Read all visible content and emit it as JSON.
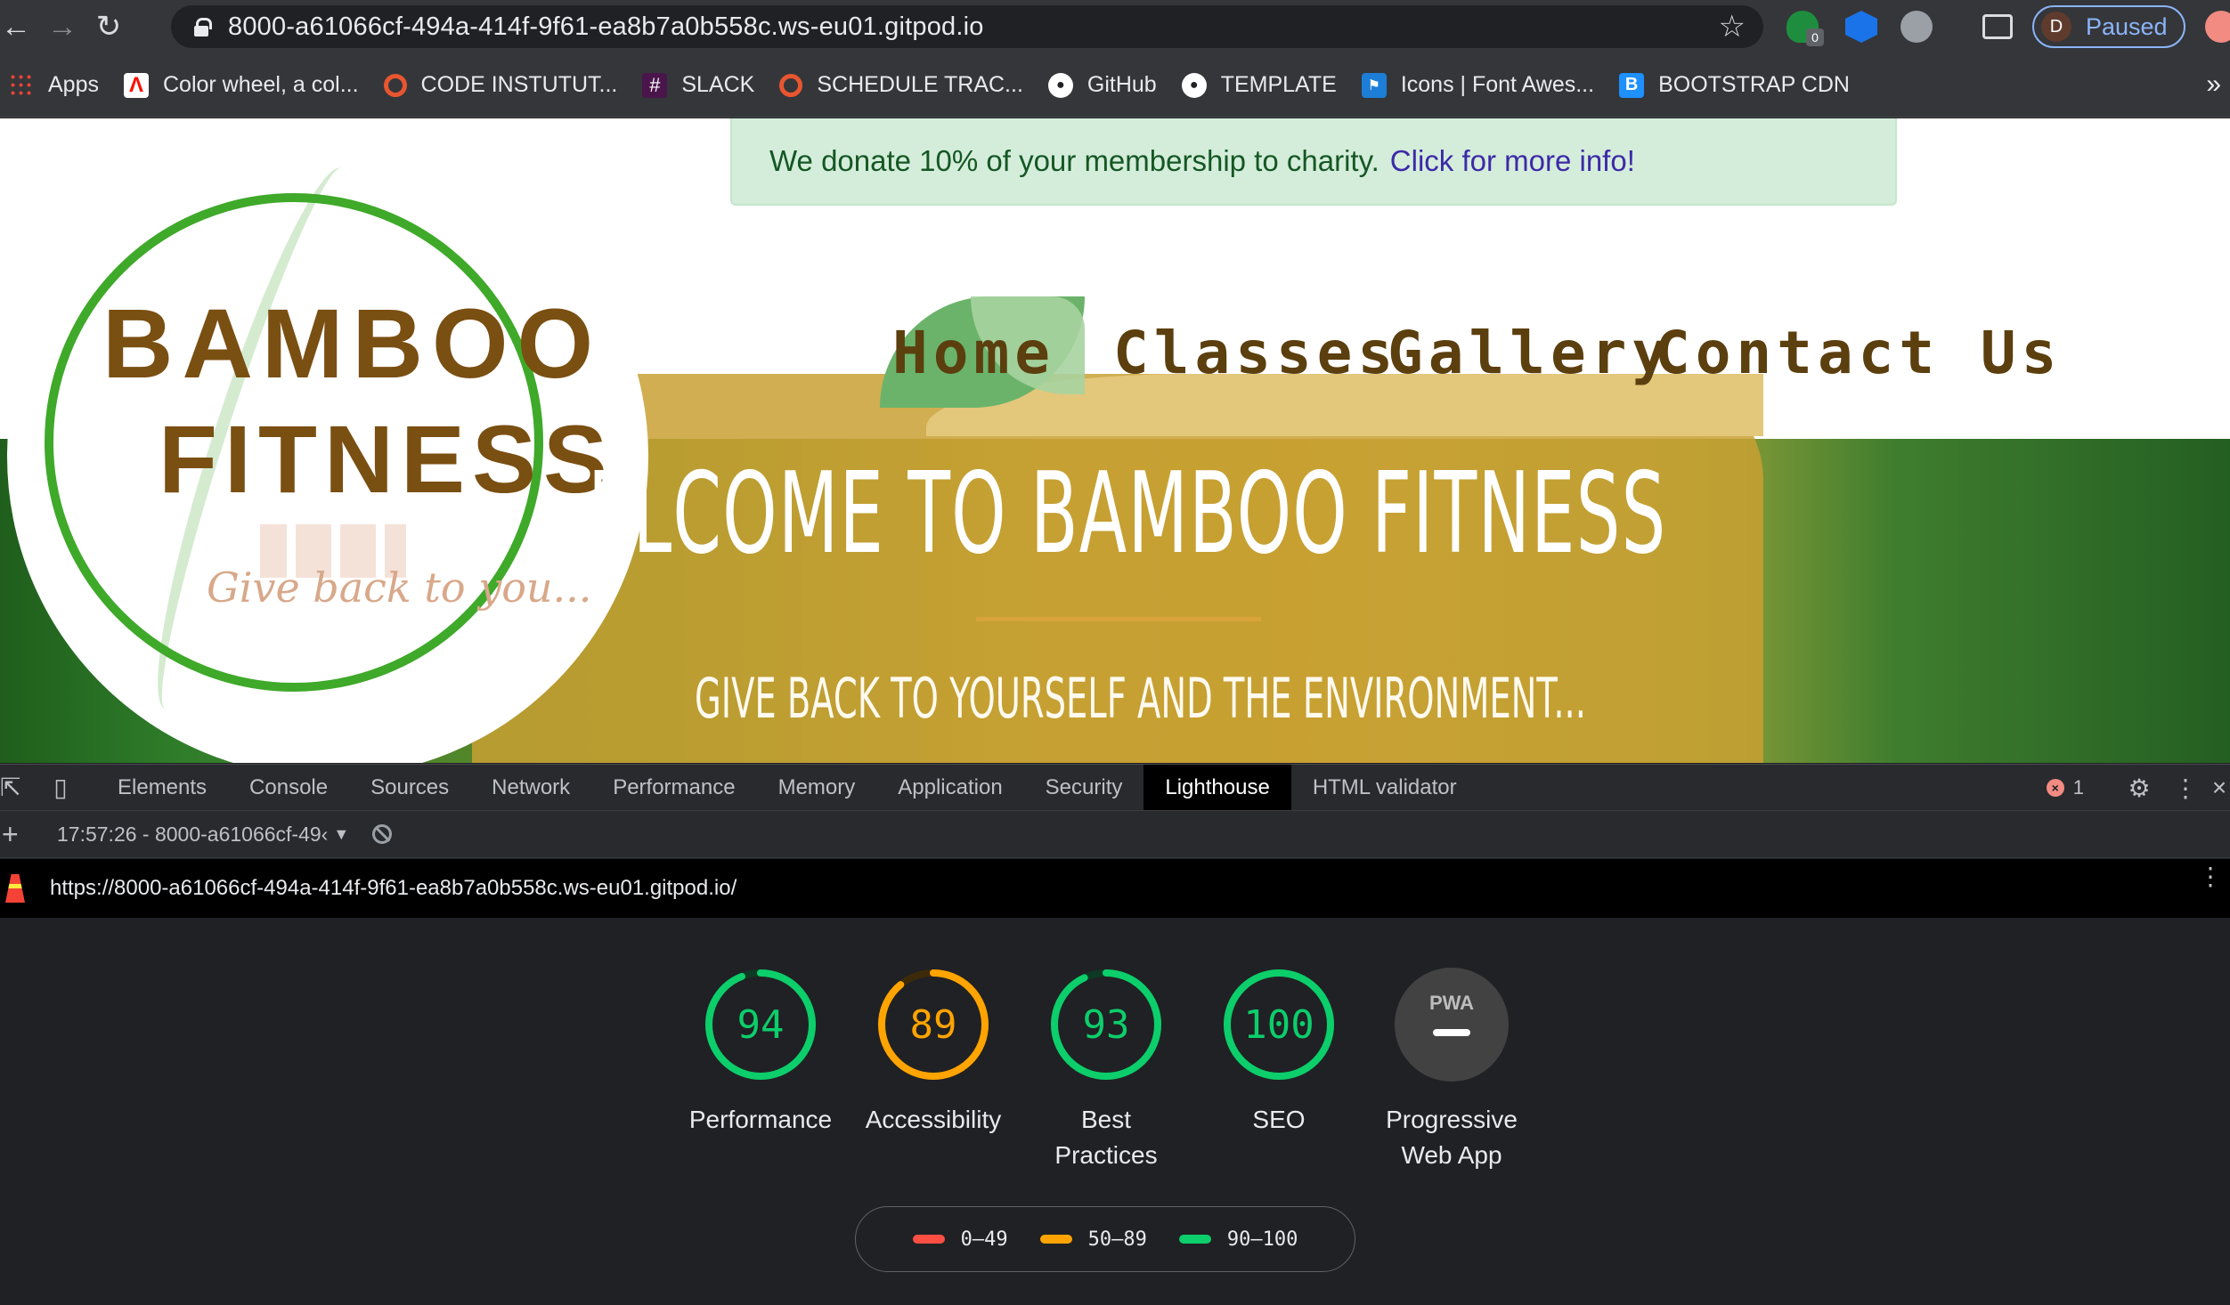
{
  "browser": {
    "url": "8000-a61066cf-494a-414f-9f61-ea8b7a0b558c.ws-eu01.gitpod.io",
    "profile_initial": "D",
    "profile_status": "Paused",
    "extension_badge": "0"
  },
  "bookmarks": [
    {
      "label": "Apps",
      "icon": "apps-grid-icon"
    },
    {
      "label": "Color wheel, a col...",
      "icon": "adobe-icon"
    },
    {
      "label": "CODE INSTUTUT...",
      "icon": "circle-o-icon"
    },
    {
      "label": "SLACK",
      "icon": "slack-icon"
    },
    {
      "label": "SCHEDULE TRAC...",
      "icon": "circle-o-icon"
    },
    {
      "label": "GitHub",
      "icon": "github-icon"
    },
    {
      "label": "TEMPLATE",
      "icon": "github-icon"
    },
    {
      "label": "Icons | Font Awes...",
      "icon": "flag-icon"
    },
    {
      "label": "BOOTSTRAP CDN",
      "icon": "bootstrap-icon"
    }
  ],
  "site": {
    "banner_text": "We donate 10% of your membership to charity.",
    "banner_link": "Click for more info!",
    "logo_line1": "BAMBOO",
    "logo_line2": "FITNESS",
    "logo_tagline": "Give back to you...",
    "nav": [
      "Home",
      "Classes",
      "Gallery",
      "Contact Us"
    ],
    "hero_title": "ELCOME TO BAMBOO FITNESS",
    "hero_tagline": "GIVE BACK TO YOURSELF AND THE ENVIRONMENT..."
  },
  "devtools": {
    "tabs": [
      "Elements",
      "Console",
      "Sources",
      "Network",
      "Performance",
      "Memory",
      "Application",
      "Security",
      "Lighthouse",
      "HTML validator"
    ],
    "active_tab": "Lighthouse",
    "error_count": "1",
    "run_label": "17:57:26 - 8000-a61066cf-49‹",
    "report_url": "https://8000-a61066cf-494a-414f-9f61-ea8b7a0b558c.ws-eu01.gitpod.io/"
  },
  "lighthouse": {
    "scores": [
      {
        "value": "94",
        "score": 94,
        "label": "Performance",
        "color": "#0cce6b"
      },
      {
        "value": "89",
        "score": 89,
        "label": "Accessibility",
        "color": "#ffa400"
      },
      {
        "value": "93",
        "score": 93,
        "label": "Best Practices",
        "color": "#0cce6b"
      },
      {
        "value": "100",
        "score": 100,
        "label": "SEO",
        "color": "#0cce6b"
      }
    ],
    "pwa": {
      "badge": "PWA",
      "label": "Progressive Web App"
    },
    "legend": [
      {
        "range": "0–49",
        "color": "#ff4e42"
      },
      {
        "range": "50–89",
        "color": "#ffa400"
      },
      {
        "range": "90–100",
        "color": "#0cce6b"
      }
    ]
  }
}
